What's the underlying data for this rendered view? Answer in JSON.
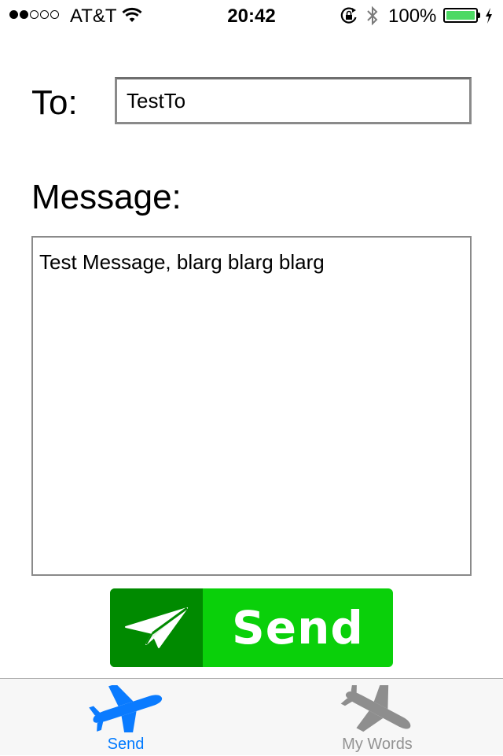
{
  "status_bar": {
    "carrier": "AT&T",
    "signal_bars_filled": 2,
    "signal_bars_total": 5,
    "time": "20:42",
    "battery_percent": "100%",
    "battery_color": "#4cd964",
    "icons": [
      "wifi-icon",
      "rotation-lock-icon",
      "bluetooth-icon",
      "charging-bolt-icon"
    ]
  },
  "form": {
    "to_label": "To:",
    "to_value": "TestTo",
    "message_label": "Message:",
    "message_value": "Test Message, blarg blarg blarg"
  },
  "send_button": {
    "label": "Send",
    "icon": "paper-plane-icon",
    "dark_color": "#008a00",
    "light_color": "#0ad00a"
  },
  "tab_bar": {
    "tabs": [
      {
        "label": "Send",
        "icon": "airplane-takeoff-icon",
        "selected": true,
        "color": "#007aff"
      },
      {
        "label": "My Words",
        "icon": "airplane-landing-icon",
        "selected": false,
        "color": "#929292"
      }
    ]
  }
}
